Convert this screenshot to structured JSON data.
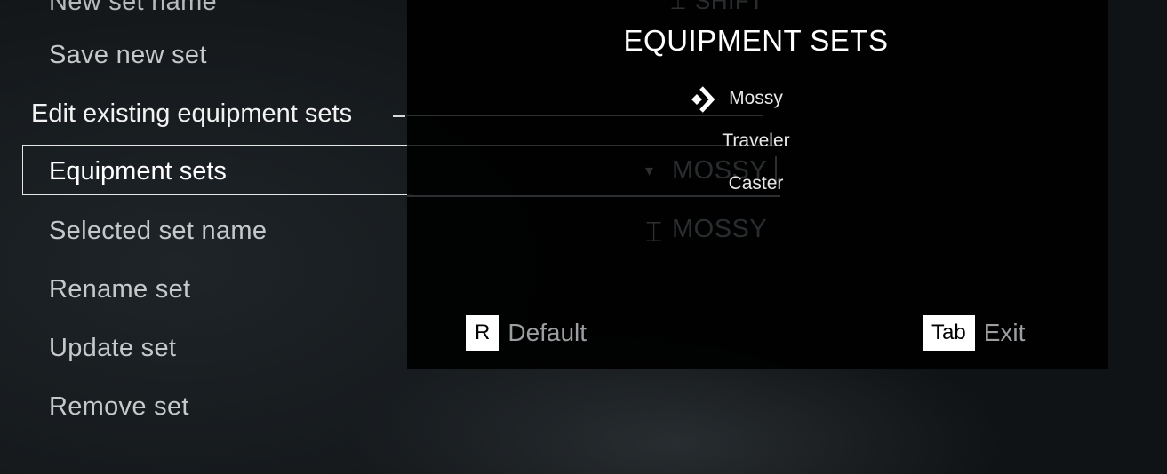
{
  "left_menu": {
    "items_top": [
      "New set name",
      "Save new set"
    ],
    "section_header": "Edit existing equipment sets",
    "focused_item": "Equipment sets",
    "items_bottom": [
      "Selected set name",
      "Rename set",
      "Update set",
      "Remove set"
    ]
  },
  "background_values": {
    "top_partial": "SHIFT",
    "equipment_sets_value": "MOSSY",
    "selected_set_name_value": "MOSSY"
  },
  "popup": {
    "title": "EQUIPMENT SETS",
    "options": [
      "Mossy",
      "Traveler",
      "Caster"
    ],
    "selected_index": 0,
    "hints": {
      "default_key": "R",
      "default_label": "Default",
      "exit_key": "Tab",
      "exit_label": "Exit"
    }
  },
  "icons": {
    "selector": "diamond-chevron-icon",
    "text_cursor": "text-cursor-icon",
    "dropdown": "dropdown-arrow-icon"
  },
  "colors": {
    "focus_border": "#e6e6e6",
    "popup_bg": "#000000",
    "key_cap_bg": "#ffffff"
  }
}
